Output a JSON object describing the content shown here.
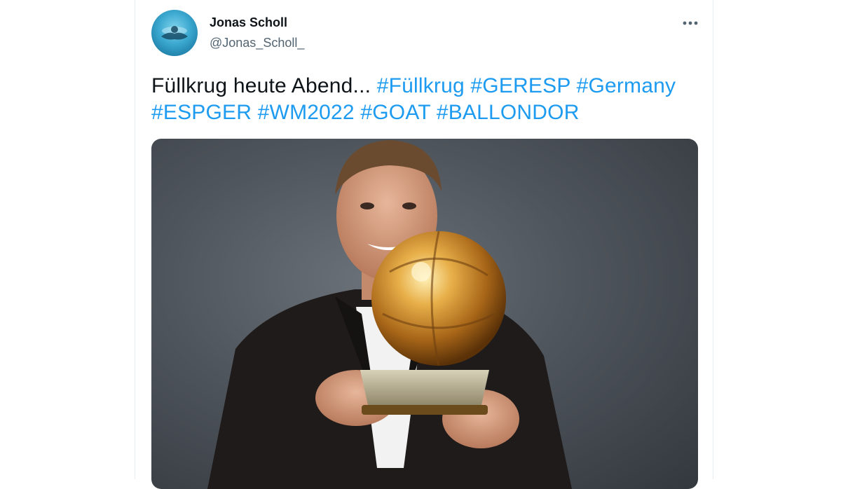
{
  "author": {
    "name": "Jonas Scholl",
    "handle": "@Jonas_Scholl_"
  },
  "tweet": {
    "text": "Füllkrug heute Abend...",
    "hashtags_line1": [
      "#Füllkrug",
      "#GERESP",
      "#Germany"
    ],
    "hashtags_line2": [
      "#ESPGER",
      "#WM2022",
      "#GOAT",
      "#BALLONDOR"
    ]
  },
  "icons": {
    "more": "more-options-icon"
  },
  "colors": {
    "hashtag": "#1d9bf0",
    "text": "#0f1419",
    "muted": "#536471"
  }
}
